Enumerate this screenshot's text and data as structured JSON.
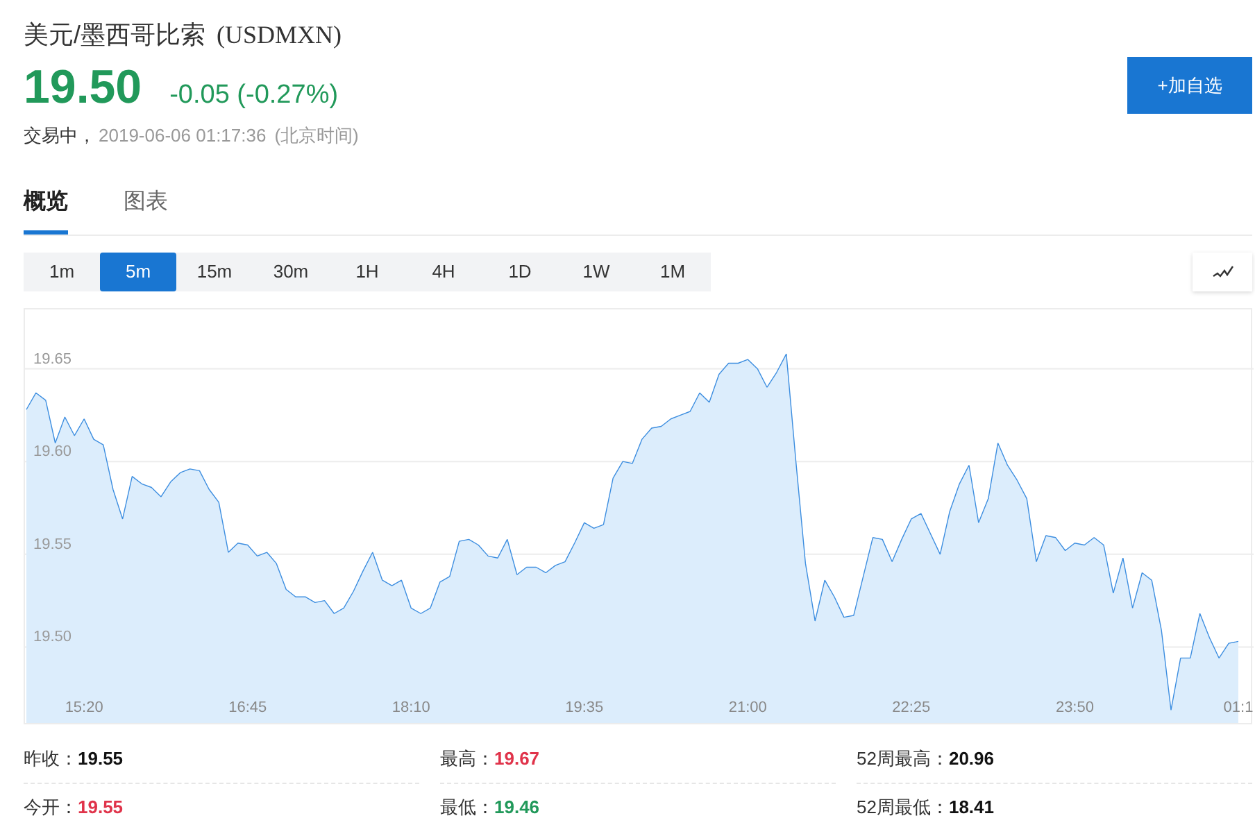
{
  "header": {
    "title": "美元/墨西哥比索",
    "symbol": "(USDMXN)",
    "price": "19.50",
    "change": "-0.05 (-0.27%)",
    "status": "交易中，",
    "timestamp": "2019-06-06 01:17:36",
    "timezone": "(北京时间)",
    "watch_button": "+加自选"
  },
  "tabs": [
    {
      "label": "概览",
      "selected": true
    },
    {
      "label": "图表",
      "selected": false
    }
  ],
  "periods": [
    {
      "label": "1m",
      "selected": false
    },
    {
      "label": "5m",
      "selected": true
    },
    {
      "label": "15m",
      "selected": false
    },
    {
      "label": "30m",
      "selected": false
    },
    {
      "label": "1H",
      "selected": false
    },
    {
      "label": "4H",
      "selected": false
    },
    {
      "label": "1D",
      "selected": false
    },
    {
      "label": "1W",
      "selected": false
    },
    {
      "label": "1M",
      "selected": false
    }
  ],
  "chart": {
    "chart_data": {
      "type": "area",
      "grid": true,
      "categories": [
        null,
        null,
        null,
        null,
        null,
        null,
        "15:20",
        null,
        null,
        null,
        null,
        null,
        null,
        null,
        null,
        null,
        null,
        null,
        null,
        null,
        null,
        null,
        null,
        "16:45",
        null,
        null,
        null,
        null,
        null,
        null,
        null,
        null,
        null,
        null,
        null,
        null,
        null,
        null,
        null,
        null,
        "18:10",
        null,
        null,
        null,
        null,
        null,
        null,
        null,
        null,
        null,
        null,
        null,
        null,
        null,
        null,
        null,
        null,
        null,
        "19:35",
        null,
        null,
        null,
        null,
        null,
        null,
        null,
        null,
        null,
        null,
        null,
        null,
        null,
        null,
        null,
        null,
        "21:00",
        null,
        null,
        null,
        null,
        null,
        null,
        null,
        null,
        null,
        null,
        null,
        null,
        null,
        null,
        null,
        null,
        "22:25",
        null,
        null,
        null,
        null,
        null,
        null,
        null,
        null,
        null,
        null,
        null,
        null,
        null,
        null,
        null,
        null,
        "23:50",
        null,
        null,
        null,
        null,
        null,
        null,
        null,
        null,
        null,
        null,
        null,
        null,
        null,
        null,
        null,
        null,
        "01:1"
      ],
      "ylim": [
        19.459,
        19.682
      ],
      "yticks": [
        {
          "value": 19.5,
          "label": "19.50"
        },
        {
          "value": 19.55,
          "label": "19.55"
        },
        {
          "value": 19.6,
          "label": "19.60"
        },
        {
          "value": 19.65,
          "label": "19.65"
        }
      ],
      "series": [
        {
          "color": "#3d8ee0",
          "values": [
            19.628,
            19.637,
            19.633,
            19.61,
            19.624,
            19.614,
            19.623,
            19.612,
            19.609,
            19.585,
            19.569,
            19.592,
            19.588,
            19.586,
            19.581,
            19.589,
            19.594,
            19.596,
            19.595,
            19.585,
            19.578,
            19.551,
            19.556,
            19.555,
            19.549,
            19.551,
            19.545,
            19.531,
            19.527,
            19.527,
            19.524,
            19.525,
            19.518,
            19.521,
            19.53,
            19.541,
            19.551,
            19.536,
            19.533,
            19.536,
            19.521,
            19.518,
            19.521,
            19.535,
            19.538,
            19.557,
            19.558,
            19.555,
            19.549,
            19.548,
            19.558,
            19.539,
            19.543,
            19.543,
            19.54,
            19.544,
            19.546,
            19.556,
            19.567,
            19.564,
            19.566,
            19.591,
            19.6,
            19.599,
            19.612,
            19.618,
            19.619,
            19.623,
            19.625,
            19.627,
            19.637,
            19.632,
            19.647,
            19.653,
            19.653,
            19.655,
            19.65,
            19.64,
            19.648,
            19.658,
            19.6,
            19.545,
            19.514,
            19.536,
            19.527,
            19.516,
            19.517,
            19.538,
            19.559,
            19.558,
            19.546,
            19.558,
            19.569,
            19.572,
            19.561,
            19.55,
            19.573,
            19.588,
            19.598,
            19.567,
            19.58,
            19.61,
            19.598,
            19.59,
            19.58,
            19.546,
            19.56,
            19.559,
            19.552,
            19.556,
            19.555,
            19.559,
            19.555,
            19.529,
            19.548,
            19.521,
            19.54,
            19.536,
            19.509,
            19.466,
            19.494,
            19.494,
            19.518,
            19.505,
            19.494,
            19.502,
            19.503
          ]
        }
      ]
    }
  },
  "stats": [
    {
      "label": "昨收：",
      "value": "19.55",
      "color": "#111111"
    },
    {
      "label": "最高：",
      "value": "19.67",
      "color": "#e0334a"
    },
    {
      "label": "52周最高：",
      "value": "20.96",
      "color": "#111111"
    },
    {
      "label": "今开：",
      "value": "19.55",
      "color": "#e0334a"
    },
    {
      "label": "最低：",
      "value": "19.46",
      "color": "#21995a"
    },
    {
      "label": "52周最低：",
      "value": "18.41",
      "color": "#111111"
    }
  ]
}
